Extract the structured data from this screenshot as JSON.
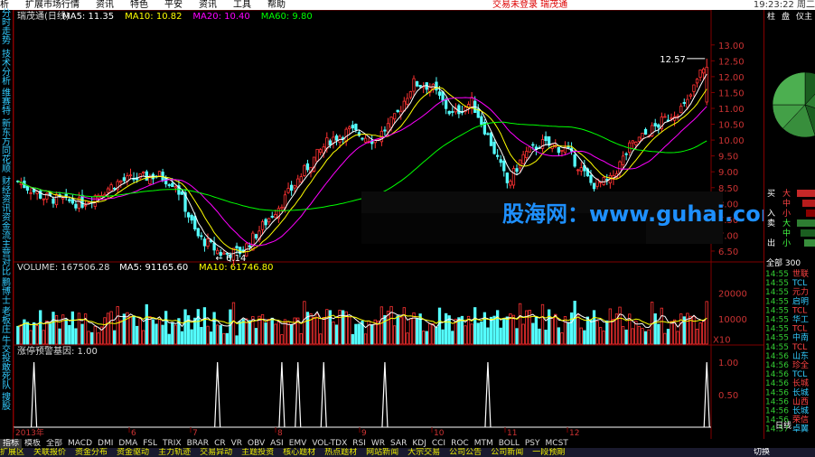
{
  "menu": {
    "items": [
      "析",
      "扩展市场行情",
      "资讯",
      "特色",
      "平安",
      "资讯",
      "工具",
      "帮助"
    ],
    "status": "交易未登录",
    "stock": "瑞茂通",
    "clock": "19:23:22 周二"
  },
  "left_tabs": [
    "分时走势",
    "技术分析",
    "维赛特",
    "新东方",
    "同花顺",
    "财经资讯",
    "资金流",
    "主营对比",
    "鹏博士",
    "老板庄",
    "牛交投",
    "敢死队",
    "搜股"
  ],
  "price_header": {
    "title": "瑞茂通(日线)",
    "ma5": "MA5: 11.35",
    "ma10": "MA10: 10.82",
    "ma20": "MA20: 10.40",
    "ma60": "MA60: 9.80"
  },
  "volume_header": {
    "vol": "VOLUME: 167506.28",
    "ma5": "MA5: 91165.60",
    "ma10": "MA10: 61746.80"
  },
  "indicator_header": {
    "label": "涨停预警基因: 1.00"
  },
  "price_axis": [
    "13.00",
    "12.50",
    "12.00",
    "11.50",
    "11.00",
    "10.50",
    "10.00",
    "9.50",
    "9.00",
    "8.50",
    "8.00",
    "7.50",
    "7.00",
    "6.50"
  ],
  "volume_axis": [
    "20000",
    "10000",
    "X10"
  ],
  "indicator_axis": [
    "1.00",
    "0.50"
  ],
  "annotations": {
    "high": "12.57",
    "low": "6.14"
  },
  "date_axis": [
    "2013年",
    "6",
    "7",
    "8",
    "9",
    "10",
    "11",
    "12"
  ],
  "watermark": "股海网：www.guhai.com.cn",
  "right_panel": {
    "tabs": [
      "柱",
      "盘",
      "仪主"
    ],
    "order_labels": [
      "买",
      "卖"
    ],
    "flow_labels": [
      "大",
      "中",
      "小",
      "大",
      "中",
      "小"
    ],
    "side_labels": [
      "入",
      "出"
    ],
    "index": "全部 300",
    "ticks": [
      {
        "time": "14:55",
        "name": "世联"
      },
      {
        "time": "14:55",
        "name": "TCL"
      },
      {
        "time": "14:55",
        "name": "元力"
      },
      {
        "time": "14:55",
        "name": "启明"
      },
      {
        "time": "14:55",
        "name": "TCL"
      },
      {
        "time": "14:55",
        "name": "华工"
      },
      {
        "time": "14:55",
        "name": "TCL"
      },
      {
        "time": "14:55",
        "name": "中南"
      },
      {
        "time": "14:55",
        "name": "TCL"
      },
      {
        "time": "14:56",
        "name": "山东"
      },
      {
        "time": "14:56",
        "name": "珍全"
      },
      {
        "time": "14:56",
        "name": "TCL"
      },
      {
        "time": "14:56",
        "name": "长城"
      },
      {
        "time": "14:56",
        "name": "长城"
      },
      {
        "time": "14:56",
        "name": "山西"
      },
      {
        "time": "14:56",
        "name": "长城"
      },
      {
        "time": "14:56",
        "name": "荣信"
      },
      {
        "time": "14:57",
        "name": "卓翼"
      }
    ],
    "period": "日线",
    "switch": "切换"
  },
  "bottom_tabs": [
    "指标",
    "模板",
    "全部",
    "MACD",
    "DMI",
    "DMA",
    "FSL",
    "TRIX",
    "BRAR",
    "CR",
    "VR",
    "OBV",
    "ASI",
    "EMV",
    "VOL-TDX",
    "RSI",
    "WR",
    "SAR",
    "KDJ",
    "CCI",
    "ROC",
    "MTM",
    "BOLL",
    "PSY",
    "MCST"
  ],
  "footer": [
    "扩展区",
    "关联报价",
    "资金分布",
    "资金驱动",
    "主力轨迹",
    "交易异动",
    "主题投资",
    "核心题材",
    "热点题材",
    "网站新闻",
    "大宗交易",
    "公司公告",
    "公司新闻",
    "一段预期"
  ],
  "colors": {
    "up": "#ff3232",
    "down": "#54ffff",
    "ma5": "#ffffff",
    "ma10": "#ffff00",
    "ma20": "#ff00ff",
    "ma60": "#00ff00",
    "grid": "#800000"
  }
}
